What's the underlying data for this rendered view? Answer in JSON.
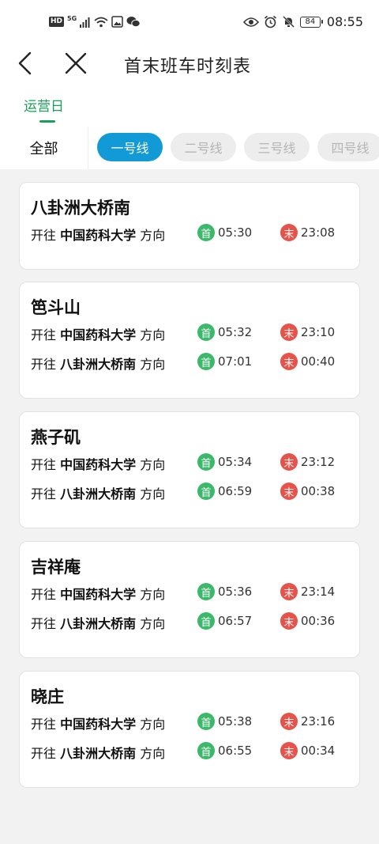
{
  "status_bar": {
    "hd": "HD",
    "signal_5g": "5G",
    "battery": "84",
    "time": "08:55"
  },
  "nav": {
    "title": "首末班车时刻表"
  },
  "day_tab": "运营日",
  "filter": {
    "all": "全部",
    "lines": [
      "一号线",
      "二号线",
      "三号线",
      "四号线"
    ]
  },
  "labels": {
    "towards_prefix": "开往",
    "towards_suffix": "方向",
    "first": "首",
    "last": "末"
  },
  "stations": [
    {
      "name": "八卦洲大桥南",
      "directions": [
        {
          "dest": "中国药科大学",
          "first": "05:30",
          "last": "23:08"
        }
      ]
    },
    {
      "name": "笆斗山",
      "directions": [
        {
          "dest": "中国药科大学",
          "first": "05:32",
          "last": "23:10"
        },
        {
          "dest": "八卦洲大桥南",
          "first": "07:01",
          "last": "00:40"
        }
      ]
    },
    {
      "name": "燕子矶",
      "directions": [
        {
          "dest": "中国药科大学",
          "first": "05:34",
          "last": "23:12"
        },
        {
          "dest": "八卦洲大桥南",
          "first": "06:59",
          "last": "00:38"
        }
      ]
    },
    {
      "name": "吉祥庵",
      "directions": [
        {
          "dest": "中国药科大学",
          "first": "05:36",
          "last": "23:14"
        },
        {
          "dest": "八卦洲大桥南",
          "first": "06:57",
          "last": "00:36"
        }
      ]
    },
    {
      "name": "晓庄",
      "directions": [
        {
          "dest": "中国药科大学",
          "first": "05:38",
          "last": "23:16"
        },
        {
          "dest": "八卦洲大桥南",
          "first": "06:55",
          "last": "00:34"
        }
      ]
    }
  ],
  "colors": {
    "accent_green": "#18a058",
    "active_line_blue": "#119ad6",
    "first_badge": "#3cb86b",
    "last_badge": "#e5534b"
  }
}
